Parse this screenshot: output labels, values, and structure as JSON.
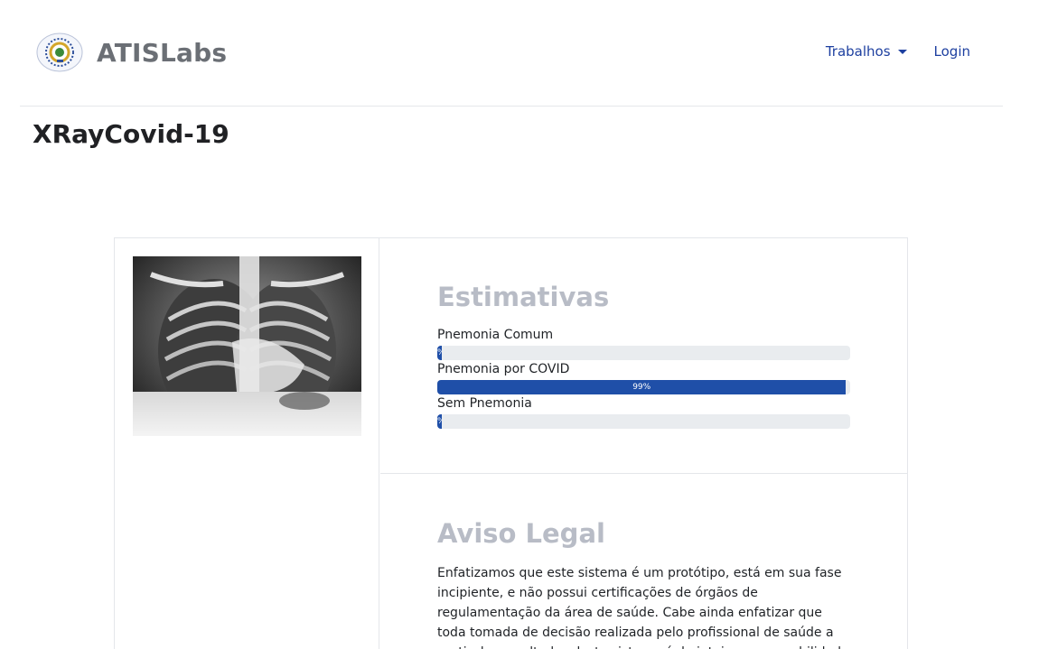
{
  "brand": {
    "name": "ATISLabs"
  },
  "nav": {
    "trabalhos": "Trabalhos",
    "login": "Login"
  },
  "page": {
    "title": "XRayCovid-19"
  },
  "estimativas": {
    "title": "Estimativas",
    "items": [
      {
        "label": "Pnemonia Comum",
        "value": 0.01,
        "text": "%"
      },
      {
        "label": "Pnemonia por COVID",
        "value": 0.99,
        "text": "99%"
      },
      {
        "label": "Sem Pnemonia",
        "value": 0.01,
        "text": "%"
      }
    ]
  },
  "aviso": {
    "title": "Aviso Legal",
    "text": "Enfatizamos que este sistema é um protótipo, está em sua fase incipiente, e não possui certificações de órgãos de regulamentação da área de saúde. Cabe ainda enfatizar que toda tomada de decisão realizada pelo profissional de saúde a partir dos resultados deste sistema é de inteira responsabilidade"
  },
  "colors": {
    "accent": "#1f4fa8",
    "link": "#1e40a0",
    "muted_title": "#b8bcc6"
  }
}
